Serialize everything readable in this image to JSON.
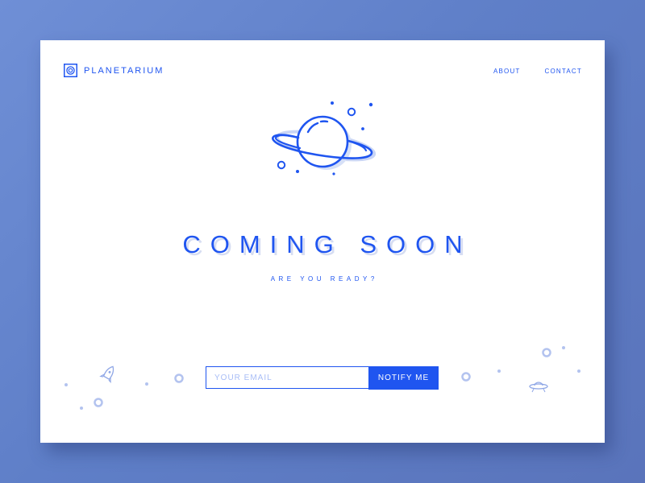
{
  "brand": {
    "name": "PLANETARIUM",
    "logo_icon": "planetarium-logo-icon"
  },
  "nav": {
    "items": [
      {
        "label": "ABOUT"
      },
      {
        "label": "CONTACT"
      }
    ]
  },
  "hero": {
    "illustration_icon": "ringed-planet-icon",
    "headline": "COMING SOON",
    "subheadline": "ARE YOU READY?"
  },
  "signup": {
    "email_placeholder": "YOUR EMAIL",
    "email_value": "",
    "button_label": "NOTIFY ME"
  },
  "decorations": {
    "icons": [
      "rocket-icon",
      "ufo-icon"
    ]
  },
  "colors": {
    "accent": "#1f55f0",
    "accent_light": "#a8bdf6",
    "card_background": "#ffffff",
    "page_background": "#5f7fc8"
  }
}
